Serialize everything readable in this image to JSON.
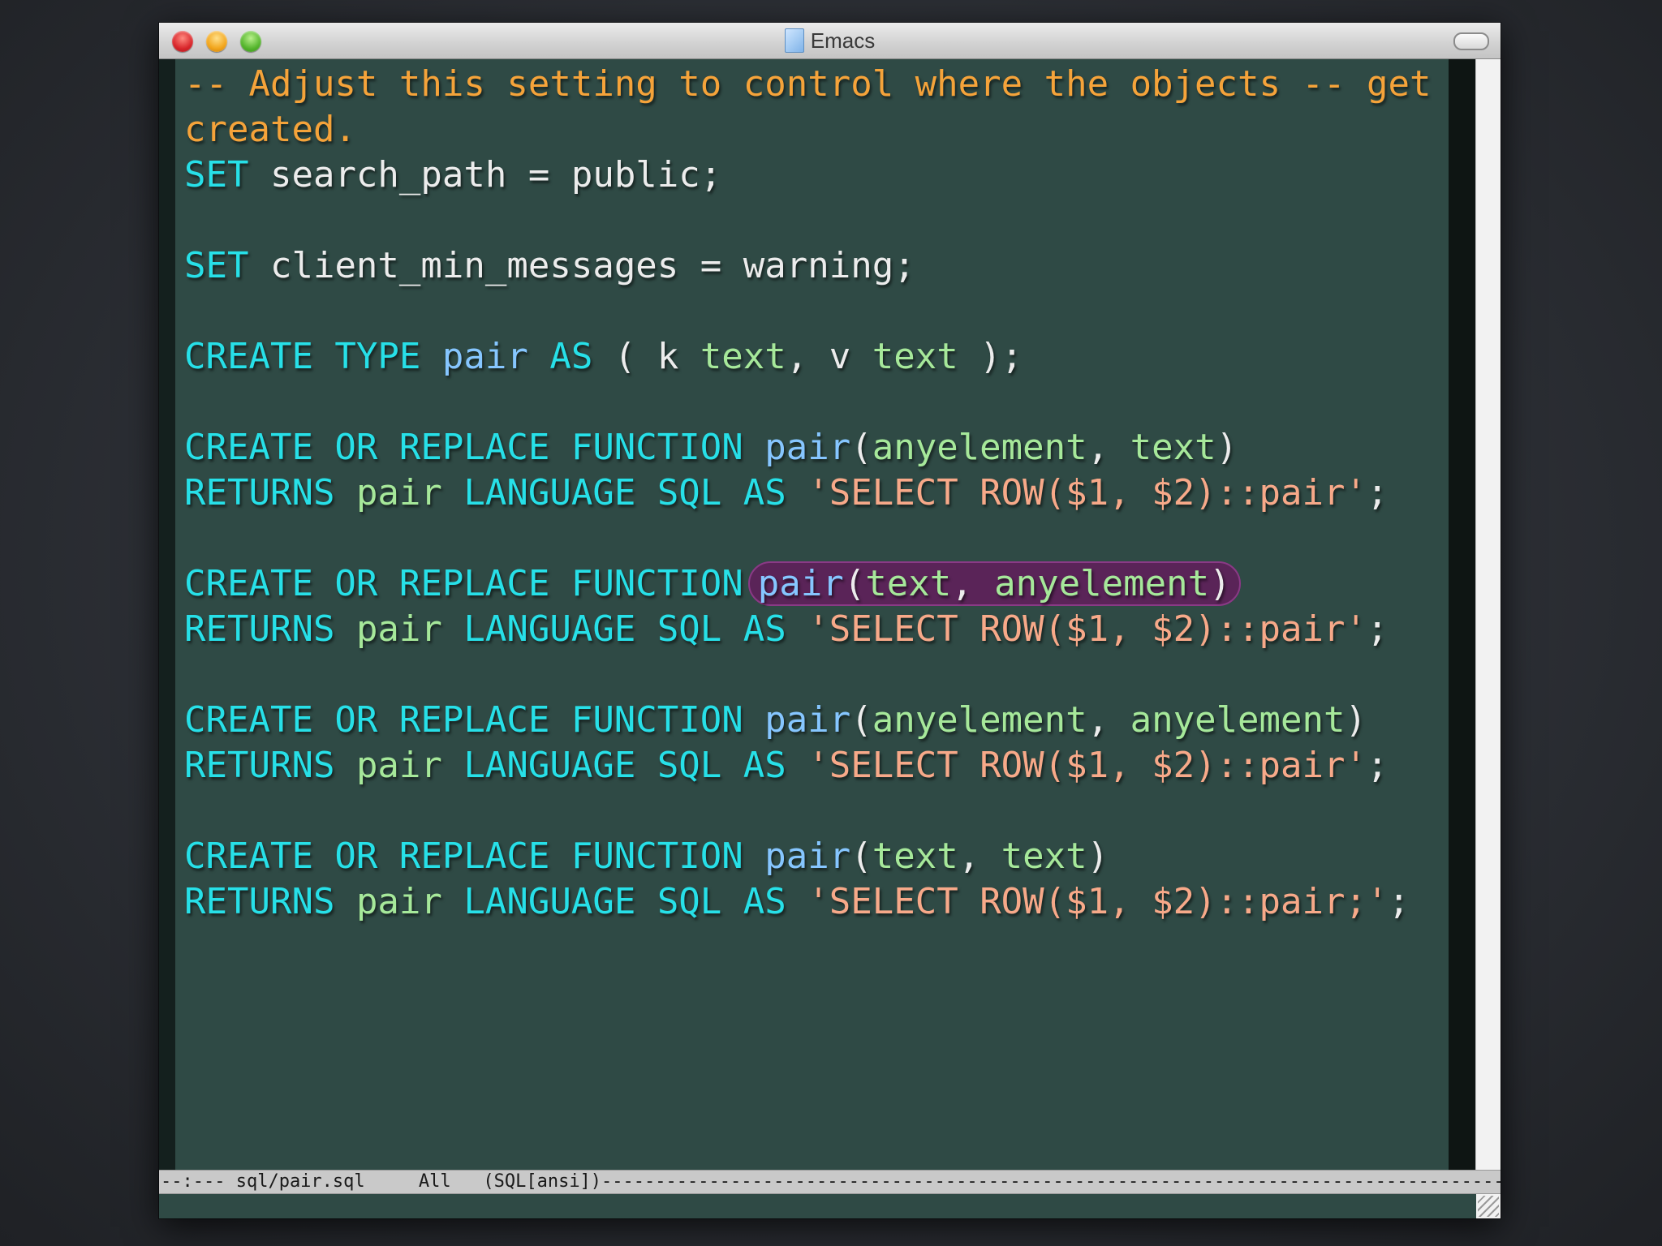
{
  "window": {
    "title": "Emacs",
    "title_icon": "document-icon"
  },
  "editor": {
    "lines": [
      [
        {
          "c": "comment",
          "t": "-- Adjust this setting to control where the objects -- get"
        }
      ],
      [
        {
          "c": "comment",
          "t": "created."
        }
      ],
      [
        {
          "c": "kw",
          "t": "SET"
        },
        {
          "c": "plain",
          "t": " search_path = public;"
        }
      ],
      [],
      [
        {
          "c": "kw",
          "t": "SET"
        },
        {
          "c": "plain",
          "t": " client_min_messages = warning;"
        }
      ],
      [],
      [
        {
          "c": "kw",
          "t": "CREATE TYPE"
        },
        {
          "c": "plain",
          "t": " "
        },
        {
          "c": "fn",
          "t": "pair"
        },
        {
          "c": "plain",
          "t": " "
        },
        {
          "c": "kw",
          "t": "AS"
        },
        {
          "c": "plain",
          "t": " ( k "
        },
        {
          "c": "type",
          "t": "text"
        },
        {
          "c": "plain",
          "t": ", v "
        },
        {
          "c": "type",
          "t": "text"
        },
        {
          "c": "plain",
          "t": " );"
        }
      ],
      [],
      [
        {
          "c": "kw",
          "t": "CREATE OR REPLACE FUNCTION"
        },
        {
          "c": "plain",
          "t": " "
        },
        {
          "c": "fn",
          "t": "pair"
        },
        {
          "c": "plain",
          "t": "("
        },
        {
          "c": "type",
          "t": "anyelement"
        },
        {
          "c": "plain",
          "t": ", "
        },
        {
          "c": "type",
          "t": "text"
        },
        {
          "c": "plain",
          "t": ")"
        }
      ],
      [
        {
          "c": "kw",
          "t": "RETURNS"
        },
        {
          "c": "plain",
          "t": " "
        },
        {
          "c": "type",
          "t": "pair"
        },
        {
          "c": "plain",
          "t": " "
        },
        {
          "c": "kw",
          "t": "LANGUAGE SQL AS"
        },
        {
          "c": "plain",
          "t": " "
        },
        {
          "c": "str",
          "t": "'SELECT ROW($1, $2)::pair'"
        },
        {
          "c": "plain",
          "t": ";"
        }
      ],
      [],
      [
        {
          "c": "kw",
          "t": "CREATE OR REPLACE FUNCTION"
        },
        {
          "c": "highlight",
          "parts": [
            {
              "c": "fn",
              "t": "pair"
            },
            {
              "c": "plain",
              "t": "("
            },
            {
              "c": "type",
              "t": "text"
            },
            {
              "c": "plain",
              "t": ", "
            },
            {
              "c": "type",
              "t": "anyelement"
            },
            {
              "c": "plain",
              "t": ")"
            }
          ]
        }
      ],
      [
        {
          "c": "kw",
          "t": "RETURNS"
        },
        {
          "c": "plain",
          "t": " "
        },
        {
          "c": "type",
          "t": "pair"
        },
        {
          "c": "plain",
          "t": " "
        },
        {
          "c": "kw",
          "t": "LANGUAGE SQL AS"
        },
        {
          "c": "plain",
          "t": " "
        },
        {
          "c": "str",
          "t": "'SELECT ROW($1, $2)::pair'"
        },
        {
          "c": "plain",
          "t": ";"
        }
      ],
      [],
      [
        {
          "c": "kw",
          "t": "CREATE OR REPLACE FUNCTION"
        },
        {
          "c": "plain",
          "t": " "
        },
        {
          "c": "fn",
          "t": "pair"
        },
        {
          "c": "plain",
          "t": "("
        },
        {
          "c": "type",
          "t": "anyelement"
        },
        {
          "c": "plain",
          "t": ", "
        },
        {
          "c": "type",
          "t": "anyelement"
        },
        {
          "c": "plain",
          "t": ")"
        }
      ],
      [
        {
          "c": "kw",
          "t": "RETURNS"
        },
        {
          "c": "plain",
          "t": " "
        },
        {
          "c": "type",
          "t": "pair"
        },
        {
          "c": "plain",
          "t": " "
        },
        {
          "c": "kw",
          "t": "LANGUAGE SQL AS"
        },
        {
          "c": "plain",
          "t": " "
        },
        {
          "c": "str",
          "t": "'SELECT ROW($1, $2)::pair'"
        },
        {
          "c": "plain",
          "t": ";"
        }
      ],
      [],
      [
        {
          "c": "kw",
          "t": "CREATE OR REPLACE FUNCTION"
        },
        {
          "c": "plain",
          "t": " "
        },
        {
          "c": "fn",
          "t": "pair"
        },
        {
          "c": "plain",
          "t": "("
        },
        {
          "c": "type",
          "t": "text"
        },
        {
          "c": "plain",
          "t": ", "
        },
        {
          "c": "type",
          "t": "text"
        },
        {
          "c": "plain",
          "t": ")"
        }
      ],
      [
        {
          "c": "kw",
          "t": "RETURNS"
        },
        {
          "c": "plain",
          "t": " "
        },
        {
          "c": "type",
          "t": "pair"
        },
        {
          "c": "plain",
          "t": " "
        },
        {
          "c": "kw",
          "t": "LANGUAGE SQL AS"
        },
        {
          "c": "plain",
          "t": " "
        },
        {
          "c": "str",
          "t": "'SELECT ROW($1, $2)::pair;'"
        },
        {
          "c": "plain",
          "t": ";"
        }
      ]
    ]
  },
  "modeline": {
    "text": "--:--- sql/pair.sql     All   (SQL[ansi])----------------------------------------------------------------------------------------------------------------------"
  },
  "colors": {
    "background": "#2f4a45",
    "keyword": "#27e0e8",
    "function": "#86c6ff",
    "type": "#a6e89a",
    "string": "#f7a989",
    "comment": "#f5a33a",
    "highlight": "#5a2458"
  }
}
